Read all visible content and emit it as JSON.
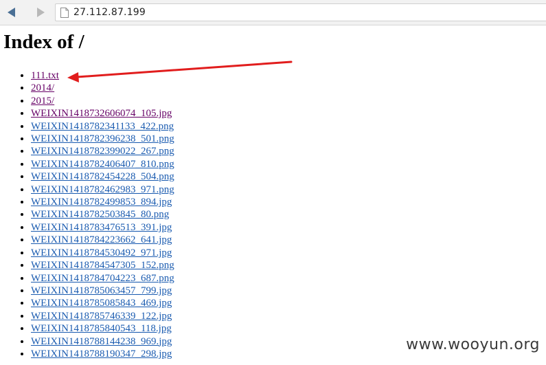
{
  "address_bar": {
    "url": "27.112.87.199"
  },
  "icons": {
    "back": "back-arrow-icon",
    "forward": "forward-arrow-icon",
    "page": "page-icon"
  },
  "colors": {
    "link": "#1a5bb0",
    "visited_link": "#660066",
    "annotation_arrow": "#e11d1d"
  },
  "page": {
    "title": "Index of /",
    "files": [
      {
        "name": "111.txt",
        "visited": true
      },
      {
        "name": "2014/",
        "visited": true
      },
      {
        "name": "2015/",
        "visited": true
      },
      {
        "name": "WEIXIN1418732606074_105.jpg",
        "visited": true
      },
      {
        "name": "WEIXIN1418782341133_422.png",
        "visited": false
      },
      {
        "name": "WEIXIN1418782396238_501.png",
        "visited": false
      },
      {
        "name": "WEIXIN1418782399022_267.png",
        "visited": false
      },
      {
        "name": "WEIXIN1418782406407_810.png",
        "visited": false
      },
      {
        "name": "WEIXIN1418782454228_504.png",
        "visited": false
      },
      {
        "name": "WEIXIN1418782462983_971.png",
        "visited": false
      },
      {
        "name": "WEIXIN1418782499853_894.jpg",
        "visited": false
      },
      {
        "name": "WEIXIN1418782503845_80.png",
        "visited": false
      },
      {
        "name": "WEIXIN1418783476513_391.jpg",
        "visited": false
      },
      {
        "name": "WEIXIN1418784223662_641.jpg",
        "visited": false
      },
      {
        "name": "WEIXIN1418784530492_971.jpg",
        "visited": false
      },
      {
        "name": "WEIXIN1418784547305_152.png",
        "visited": false
      },
      {
        "name": "WEIXIN1418784704223_687.png",
        "visited": false
      },
      {
        "name": "WEIXIN1418785063457_799.jpg",
        "visited": false
      },
      {
        "name": "WEIXIN1418785085843_469.jpg",
        "visited": false
      },
      {
        "name": "WEIXIN1418785746339_122.jpg",
        "visited": false
      },
      {
        "name": "WEIXIN1418785840543_118.jpg",
        "visited": false
      },
      {
        "name": "WEIXIN1418788144238_969.jpg",
        "visited": false
      },
      {
        "name": "WEIXIN1418788190347_298.jpg",
        "visited": false
      }
    ]
  },
  "watermark": {
    "text": "www.wooyun.org"
  }
}
